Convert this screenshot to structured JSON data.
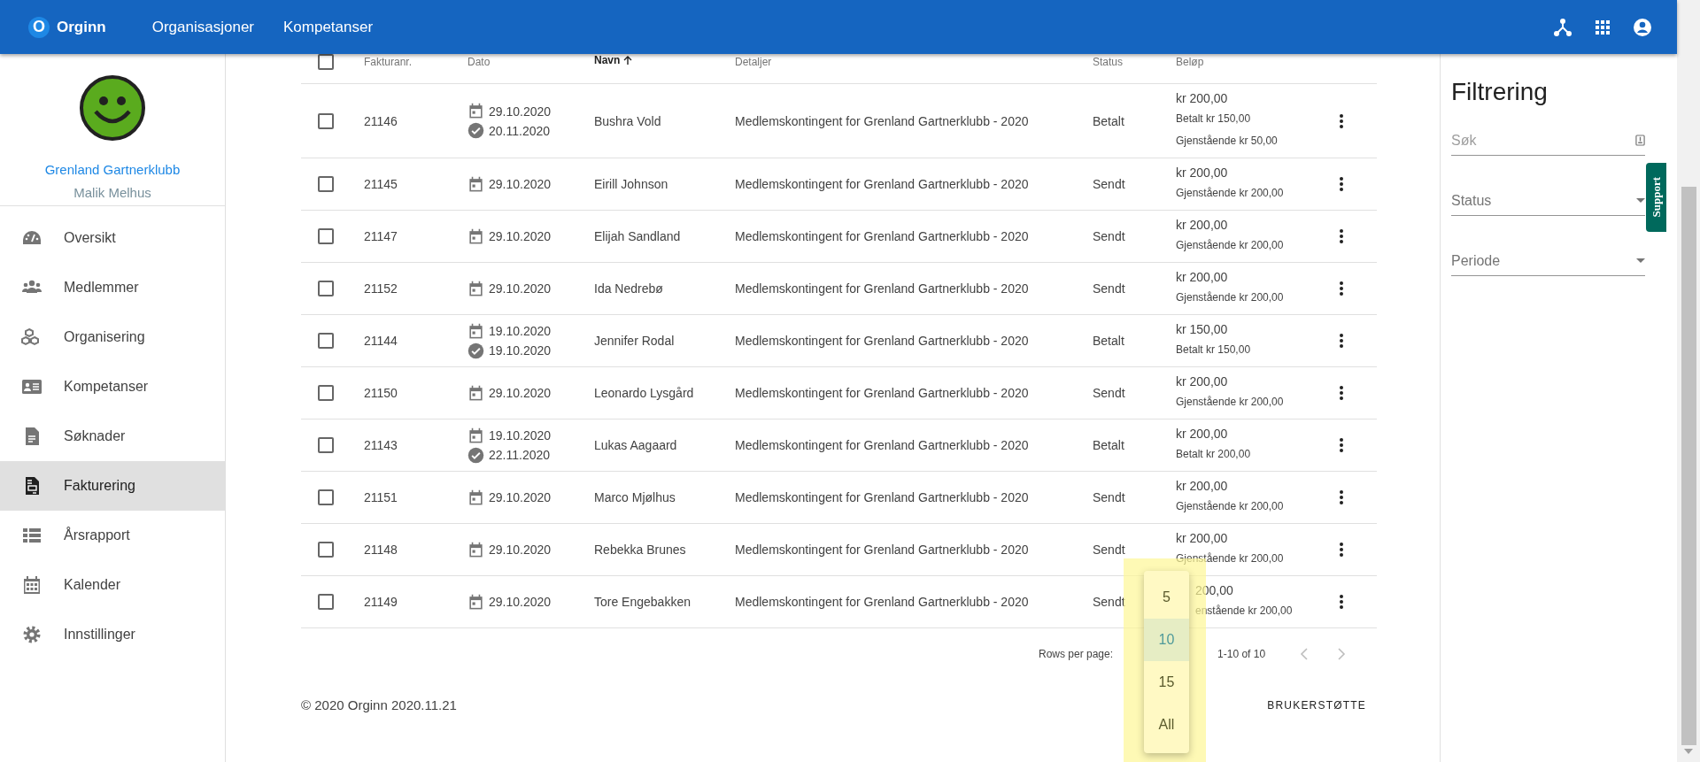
{
  "app": {
    "logo_letter": "O",
    "name": "Orginn"
  },
  "nav": [
    {
      "label": "Organisasjoner"
    },
    {
      "label": "Kompetanser"
    }
  ],
  "sidebar": {
    "org": "Grenland Gartnerklubb",
    "user": "Malik Melhus",
    "items": [
      {
        "label": "Oversikt",
        "kind": "gauge",
        "selected": false
      },
      {
        "label": "Medlemmer",
        "kind": "people",
        "selected": false
      },
      {
        "label": "Organisering",
        "kind": "cubes",
        "selected": false
      },
      {
        "label": "Kompetanser",
        "kind": "card",
        "selected": false
      },
      {
        "label": "Søknader",
        "kind": "document",
        "selected": false
      },
      {
        "label": "Fakturering",
        "kind": "invoice",
        "selected": true
      },
      {
        "label": "Årsrapport",
        "kind": "list",
        "selected": false
      },
      {
        "label": "Kalender",
        "kind": "calendar",
        "selected": false
      },
      {
        "label": "Innstillinger",
        "kind": "gear",
        "selected": false
      }
    ]
  },
  "table": {
    "select_all": {
      "checked": false
    },
    "columns": [
      {
        "label": "Fakturanr.",
        "sorted": false
      },
      {
        "label": "Dato",
        "sorted": false
      },
      {
        "label": "Navn",
        "sorted": true
      },
      {
        "label": "Detaljer",
        "sorted": false
      },
      {
        "label": "Status",
        "sorted": false
      },
      {
        "label": "Beløp",
        "sorted": false
      }
    ],
    "rows": [
      {
        "checked": false,
        "number": "21146",
        "dates": [
          {
            "kind": "issued",
            "text": "29.10.2020"
          },
          {
            "kind": "paid",
            "text": "20.11.2020"
          }
        ],
        "name": "Bushra Vold",
        "details": "Medlemskontingent for Grenland Gartnerklubb - 2020",
        "status": "Betalt",
        "amount": "kr 200,00",
        "breakdown": [
          "Betalt kr 150,00",
          "Gjenstående kr 50,00"
        ]
      },
      {
        "checked": false,
        "number": "21145",
        "dates": [
          {
            "kind": "issued",
            "text": "29.10.2020"
          }
        ],
        "name": "Eirill Johnson",
        "details": "Medlemskontingent for Grenland Gartnerklubb - 2020",
        "status": "Sendt",
        "amount": "kr 200,00",
        "breakdown": [
          "Gjenstående kr 200,00"
        ]
      },
      {
        "checked": false,
        "number": "21147",
        "dates": [
          {
            "kind": "issued",
            "text": "29.10.2020"
          }
        ],
        "name": "Elijah Sandland",
        "details": "Medlemskontingent for Grenland Gartnerklubb - 2020",
        "status": "Sendt",
        "amount": "kr 200,00",
        "breakdown": [
          "Gjenstående kr 200,00"
        ]
      },
      {
        "checked": false,
        "number": "21152",
        "dates": [
          {
            "kind": "issued",
            "text": "29.10.2020"
          }
        ],
        "name": "Ida Nedrebø",
        "details": "Medlemskontingent for Grenland Gartnerklubb - 2020",
        "status": "Sendt",
        "amount": "kr 200,00",
        "breakdown": [
          "Gjenstående kr 200,00"
        ]
      },
      {
        "checked": false,
        "number": "21144",
        "dates": [
          {
            "kind": "issued",
            "text": "19.10.2020"
          },
          {
            "kind": "paid",
            "text": "19.10.2020"
          }
        ],
        "name": "Jennifer Rodal",
        "details": "Medlemskontingent for Grenland Gartnerklubb - 2020",
        "status": "Betalt",
        "amount": "kr 150,00",
        "breakdown": [
          "Betalt kr 150,00"
        ]
      },
      {
        "checked": false,
        "number": "21150",
        "dates": [
          {
            "kind": "issued",
            "text": "29.10.2020"
          }
        ],
        "name": "Leonardo Lysgård",
        "details": "Medlemskontingent for Grenland Gartnerklubb - 2020",
        "status": "Sendt",
        "amount": "kr 200,00",
        "breakdown": [
          "Gjenstående kr 200,00"
        ]
      },
      {
        "checked": false,
        "number": "21143",
        "dates": [
          {
            "kind": "issued",
            "text": "19.10.2020"
          },
          {
            "kind": "paid",
            "text": "22.11.2020"
          }
        ],
        "name": "Lukas Aagaard",
        "details": "Medlemskontingent for Grenland Gartnerklubb - 2020",
        "status": "Betalt",
        "amount": "kr 200,00",
        "breakdown": [
          "Betalt kr 200,00"
        ]
      },
      {
        "checked": false,
        "number": "21151",
        "dates": [
          {
            "kind": "issued",
            "text": "29.10.2020"
          }
        ],
        "name": "Marco Mjølhus",
        "details": "Medlemskontingent for Grenland Gartnerklubb - 2020",
        "status": "Sendt",
        "amount": "kr 200,00",
        "breakdown": [
          "Gjenstående kr 200,00"
        ]
      },
      {
        "checked": false,
        "number": "21148",
        "dates": [
          {
            "kind": "issued",
            "text": "29.10.2020"
          }
        ],
        "name": "Rebekka Brunes",
        "details": "Medlemskontingent for Grenland Gartnerklubb - 2020",
        "status": "Sendt",
        "amount": "kr 200,00",
        "breakdown": [
          "Gjenstående kr 200,00"
        ]
      },
      {
        "checked": false,
        "number": "21149",
        "dates": [
          {
            "kind": "issued",
            "text": "29.10.2020"
          }
        ],
        "name": "Tore Engebakken",
        "details": "Medlemskontingent for Grenland Gartnerklubb - 2020",
        "status": "Sendt",
        "amount": "200,00",
        "breakdown": [
          "enstående kr 200,00"
        ],
        "partly_covered": true
      }
    ]
  },
  "pagination": {
    "label": "Rows per page:",
    "range": "1-10 of 10",
    "prev": {
      "disabled": true
    },
    "next": {
      "disabled": true
    }
  },
  "rows_menu": [
    {
      "label": "5",
      "selected": false
    },
    {
      "label": "10",
      "selected": true
    },
    {
      "label": "15",
      "selected": false
    },
    {
      "label": "All",
      "selected": false
    }
  ],
  "footer": {
    "copyright": "© 2020 Orginn 2020.11.21",
    "link": "BRUKERSTØTTE"
  },
  "filter": {
    "title": "Filtrering",
    "fields": [
      {
        "kind": "text",
        "placeholder": "Søk"
      },
      {
        "kind": "select",
        "label": "Status"
      },
      {
        "kind": "select",
        "label": "Periode"
      }
    ]
  },
  "support_tab": "Support"
}
